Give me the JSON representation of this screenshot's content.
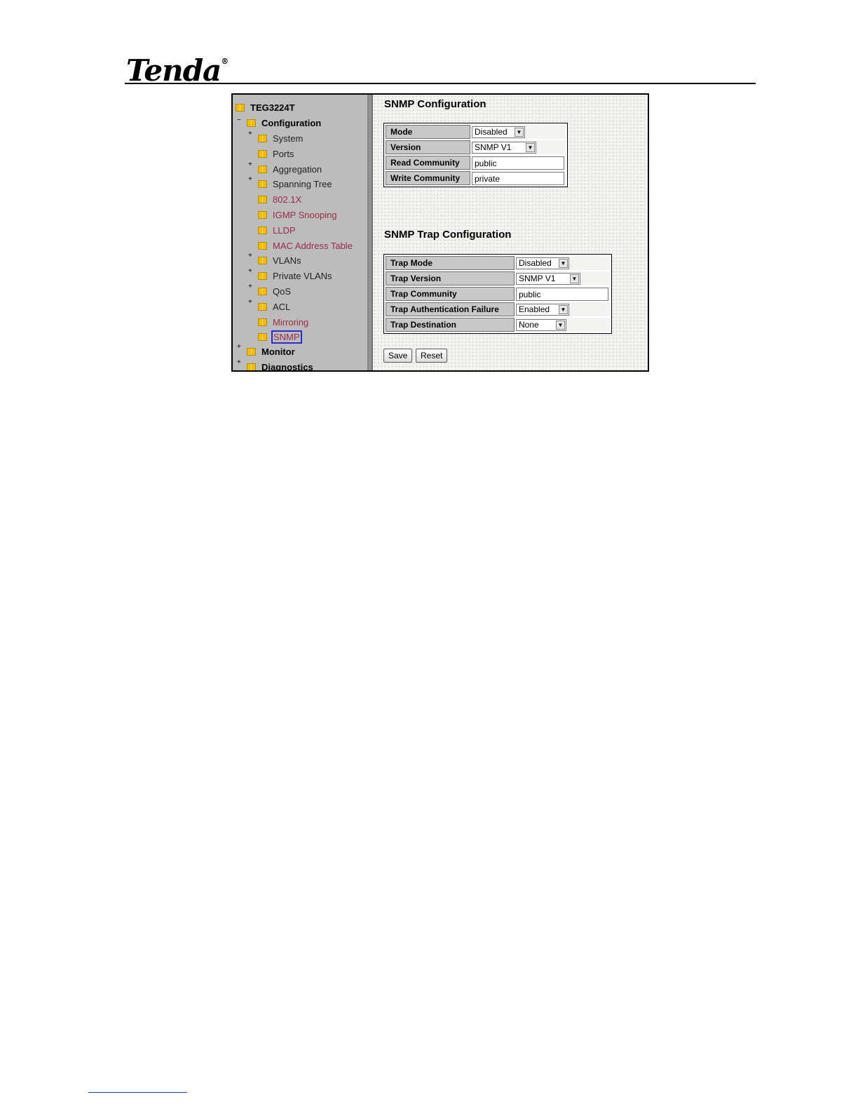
{
  "brand": {
    "logo_text": "Tenda",
    "reg_mark": "®"
  },
  "tree": {
    "root": "TEG3224T",
    "configuration": "Configuration",
    "items": [
      {
        "label": "System",
        "expander": "+",
        "style": "plain"
      },
      {
        "label": "Ports",
        "expander": "",
        "style": "plain"
      },
      {
        "label": "Aggregation",
        "expander": "+",
        "style": "plain"
      },
      {
        "label": "Spanning Tree",
        "expander": "+",
        "style": "plain"
      },
      {
        "label": "802.1X",
        "expander": "",
        "style": "link"
      },
      {
        "label": "IGMP Snooping",
        "expander": "",
        "style": "link"
      },
      {
        "label": "LLDP",
        "expander": "",
        "style": "link"
      },
      {
        "label": "MAC Address Table",
        "expander": "",
        "style": "link"
      },
      {
        "label": "VLANs",
        "expander": "+",
        "style": "plain"
      },
      {
        "label": "Private VLANs",
        "expander": "+",
        "style": "plain"
      },
      {
        "label": "QoS",
        "expander": "+",
        "style": "plain"
      },
      {
        "label": "ACL",
        "expander": "+",
        "style": "plain"
      },
      {
        "label": "Mirroring",
        "expander": "",
        "style": "link"
      },
      {
        "label": "SNMP",
        "expander": "",
        "style": "selected"
      }
    ],
    "monitor": "Monitor",
    "diagnostics": "Diagnostics"
  },
  "snmp": {
    "title": "SNMP Configuration",
    "mode_label": "Mode",
    "mode_value": "Disabled",
    "version_label": "Version",
    "version_value": "SNMP V1",
    "read_label": "Read Community",
    "read_value": "public",
    "write_label": "Write Community",
    "write_value": "private"
  },
  "trap": {
    "title": "SNMP Trap Configuration",
    "mode_label": "Trap Mode",
    "mode_value": "Disabled",
    "version_label": "Trap Version",
    "version_value": "SNMP V1",
    "community_label": "Trap Community",
    "community_value": "public",
    "auth_label": "Trap Authentication Failure",
    "auth_value": "Enabled",
    "dest_label": "Trap Destination",
    "dest_value": "None"
  },
  "buttons": {
    "save": "Save",
    "reset": "Reset"
  },
  "icons": {
    "dropdown": "chevron-down-icon",
    "folder": "folder-icon",
    "expander": "plus-icon"
  }
}
